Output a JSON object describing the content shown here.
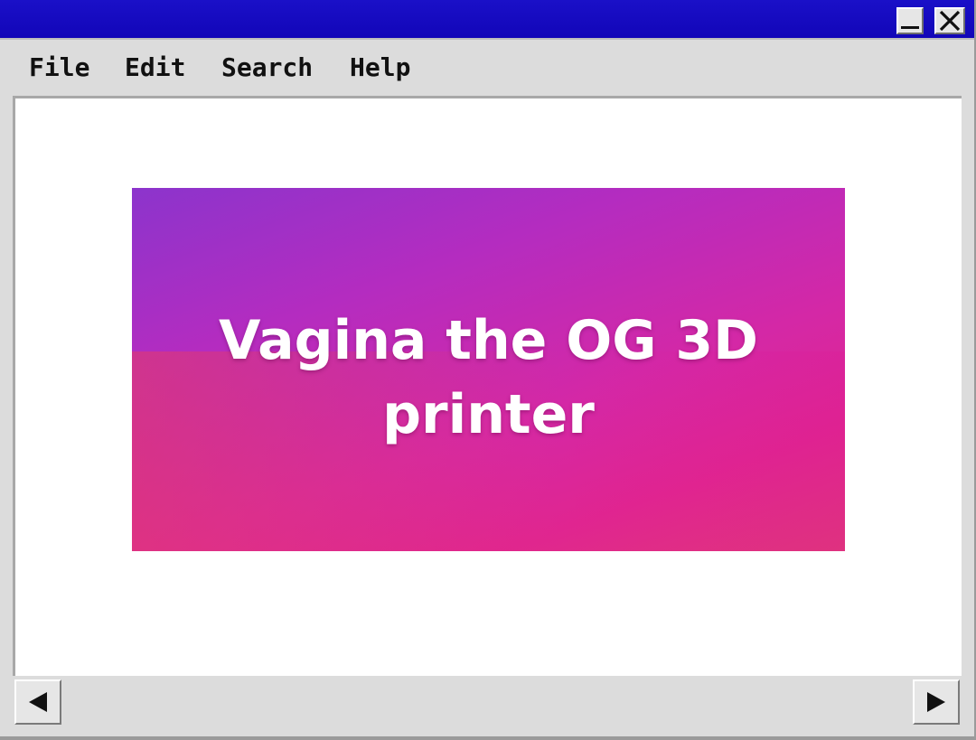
{
  "window": {
    "title": "",
    "controls": {
      "minimize_icon": "minimize-icon",
      "close_icon": "close-icon"
    }
  },
  "menu": {
    "items": [
      {
        "label": "File"
      },
      {
        "label": "Edit"
      },
      {
        "label": "Search"
      },
      {
        "label": "Help"
      }
    ]
  },
  "content": {
    "banner_text": "Vagina the OG 3D printer"
  },
  "scrollbar": {
    "left_icon": "arrow-left-icon",
    "right_icon": "arrow-right-icon"
  },
  "colors": {
    "title_bar": "#1a10c8",
    "window_bg": "#dcdcdc",
    "banner_start": "#8c34cc",
    "banner_end": "#e02590"
  }
}
